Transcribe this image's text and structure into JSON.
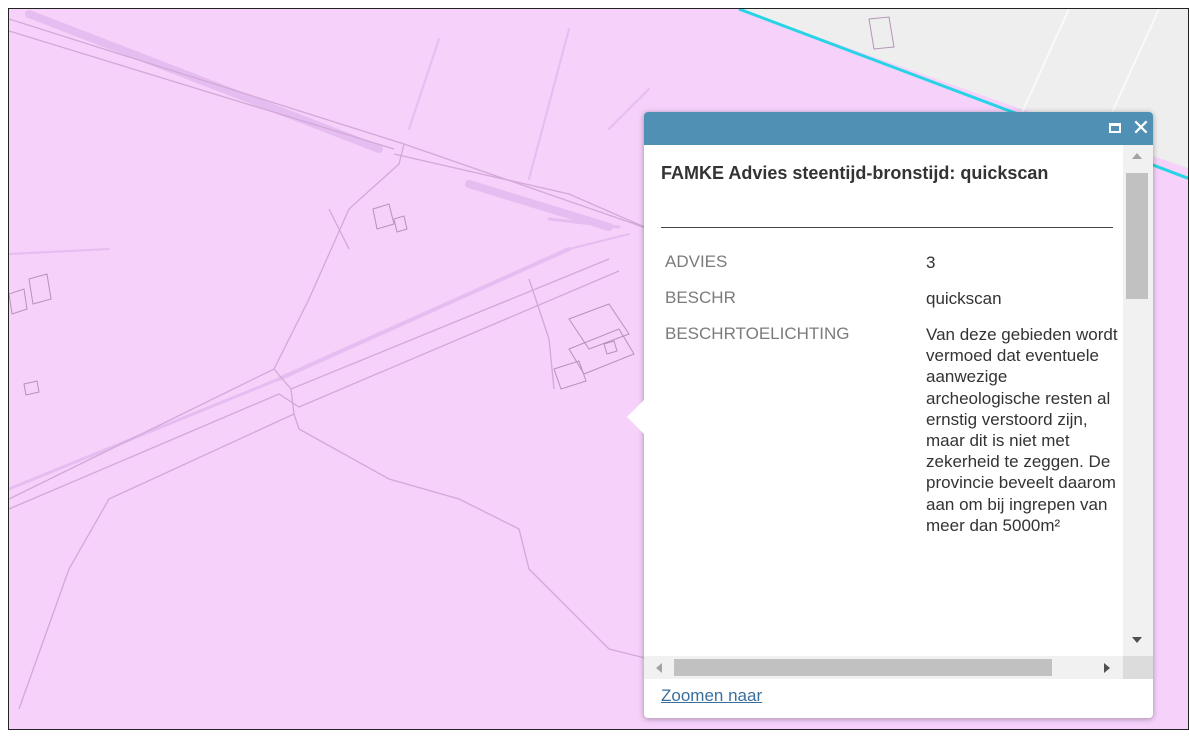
{
  "map": {
    "background_color": "#f6d1fa",
    "road_color": "#d4a8d8",
    "water_color": "#e6bdf0",
    "building_color": "#b693b8",
    "boundary_color": "#27d4e6",
    "neighbor_area_color": "#eeeeee"
  },
  "popup": {
    "header_color": "#5190b5",
    "maximize_icon": "maximize-icon",
    "close_icon": "close-icon",
    "close_symbol": "✕",
    "title": "FAMKE Advies steentijd-bronstijd: quickscan",
    "attributes": [
      {
        "key": "ADVIES",
        "value": "3"
      },
      {
        "key": "BESCHR",
        "value": "quickscan"
      },
      {
        "key": "BESCHRTOELICHTING",
        "value": "Van deze gebieden wordt vermoed dat eventuele aanwezige archeologische resten al ernstig verstoord zijn, maar dit is niet met zekerheid te zeggen. De provincie beveelt daarom aan om bij ingrepen van meer dan 5000m² "
      }
    ],
    "zoom_link": "Zoomen naar"
  }
}
